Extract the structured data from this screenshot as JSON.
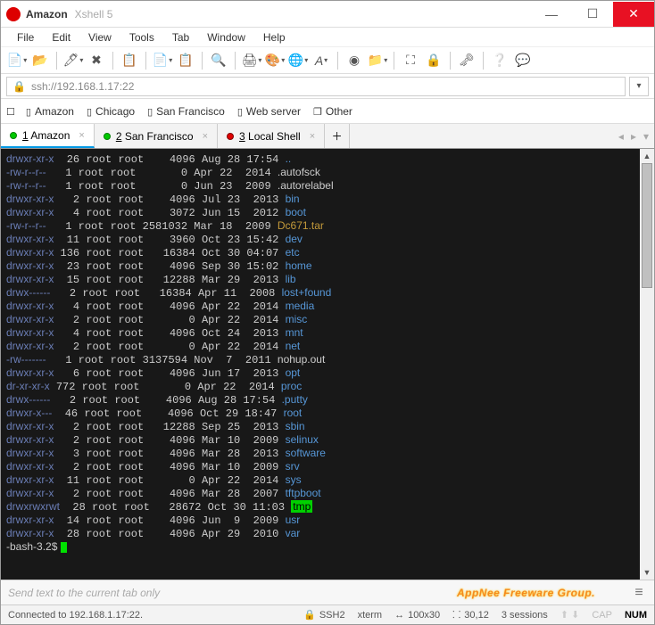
{
  "title": {
    "main": "Amazon",
    "sub": "Xshell 5"
  },
  "menu": [
    "File",
    "Edit",
    "View",
    "Tools",
    "Tab",
    "Window",
    "Help"
  ],
  "address": "ssh://192.168.1.17:22",
  "bookmarks": [
    "Amazon",
    "Chicago",
    "San Francisco",
    "Web server",
    "Other"
  ],
  "tabs": [
    {
      "dot": "green",
      "label": "1 Amazon",
      "active": true,
      "underline": "1"
    },
    {
      "dot": "green",
      "label": "2 San Francisco",
      "active": false,
      "underline": "2"
    },
    {
      "dot": "red",
      "label": "3 Local Shell",
      "active": false,
      "underline": "3"
    }
  ],
  "listing": [
    {
      "perm": "drwxr-xr-x",
      "n": "26",
      "u": "root",
      "g": "root",
      "sz": "4096",
      "d": "Aug 28 17:54",
      "name": "..",
      "cls": "dir"
    },
    {
      "perm": "-rw-r--r--",
      "n": "1",
      "u": "root",
      "g": "root",
      "sz": "0",
      "d": "Apr 22  2014",
      "name": ".autofsck",
      "cls": "file"
    },
    {
      "perm": "-rw-r--r--",
      "n": "1",
      "u": "root",
      "g": "root",
      "sz": "0",
      "d": "Jun 23  2009",
      "name": ".autorelabel",
      "cls": "file"
    },
    {
      "perm": "drwxr-xr-x",
      "n": "2",
      "u": "root",
      "g": "root",
      "sz": "4096",
      "d": "Jul 23  2013",
      "name": "bin",
      "cls": "dir"
    },
    {
      "perm": "drwxr-xr-x",
      "n": "4",
      "u": "root",
      "g": "root",
      "sz": "3072",
      "d": "Jun 15  2012",
      "name": "boot",
      "cls": "dir"
    },
    {
      "perm": "-rw-r--r--",
      "n": "1",
      "u": "root",
      "g": "root",
      "sz": "2581032",
      "d": "Mar 18  2009",
      "name": "Dc671.tar",
      "cls": "arch"
    },
    {
      "perm": "drwxr-xr-x",
      "n": "11",
      "u": "root",
      "g": "root",
      "sz": "3960",
      "d": "Oct 23 15:42",
      "name": "dev",
      "cls": "dir"
    },
    {
      "perm": "drwxr-xr-x",
      "n": "136",
      "u": "root",
      "g": "root",
      "sz": "16384",
      "d": "Oct 30 04:07",
      "name": "etc",
      "cls": "dir"
    },
    {
      "perm": "drwxr-xr-x",
      "n": "23",
      "u": "root",
      "g": "root",
      "sz": "4096",
      "d": "Sep 30 15:02",
      "name": "home",
      "cls": "dir"
    },
    {
      "perm": "drwxr-xr-x",
      "n": "15",
      "u": "root",
      "g": "root",
      "sz": "12288",
      "d": "Mar 29  2013",
      "name": "lib",
      "cls": "dir"
    },
    {
      "perm": "drwx------",
      "n": "2",
      "u": "root",
      "g": "root",
      "sz": "16384",
      "d": "Apr 11  2008",
      "name": "lost+found",
      "cls": "lost"
    },
    {
      "perm": "drwxr-xr-x",
      "n": "4",
      "u": "root",
      "g": "root",
      "sz": "4096",
      "d": "Apr 22  2014",
      "name": "media",
      "cls": "dir"
    },
    {
      "perm": "drwxr-xr-x",
      "n": "2",
      "u": "root",
      "g": "root",
      "sz": "0",
      "d": "Apr 22  2014",
      "name": "misc",
      "cls": "dir"
    },
    {
      "perm": "drwxr-xr-x",
      "n": "4",
      "u": "root",
      "g": "root",
      "sz": "4096",
      "d": "Oct 24  2013",
      "name": "mnt",
      "cls": "dir"
    },
    {
      "perm": "drwxr-xr-x",
      "n": "2",
      "u": "root",
      "g": "root",
      "sz": "0",
      "d": "Apr 22  2014",
      "name": "net",
      "cls": "dir"
    },
    {
      "perm": "-rw-------",
      "n": "1",
      "u": "root",
      "g": "root",
      "sz": "3137594",
      "d": "Nov  7  2011",
      "name": "nohup.out",
      "cls": "file"
    },
    {
      "perm": "drwxr-xr-x",
      "n": "6",
      "u": "root",
      "g": "root",
      "sz": "4096",
      "d": "Jun 17  2013",
      "name": "opt",
      "cls": "dir"
    },
    {
      "perm": "dr-xr-xr-x",
      "n": "772",
      "u": "root",
      "g": "root",
      "sz": "0",
      "d": "Apr 22  2014",
      "name": "proc",
      "cls": "dir"
    },
    {
      "perm": "drwx------",
      "n": "2",
      "u": "root",
      "g": "root",
      "sz": "4096",
      "d": "Aug 28 17:54",
      "name": ".putty",
      "cls": "dir"
    },
    {
      "perm": "drwxr-x---",
      "n": "46",
      "u": "root",
      "g": "root",
      "sz": "4096",
      "d": "Oct 29 18:47",
      "name": "root",
      "cls": "dir"
    },
    {
      "perm": "drwxr-xr-x",
      "n": "2",
      "u": "root",
      "g": "root",
      "sz": "12288",
      "d": "Sep 25  2013",
      "name": "sbin",
      "cls": "dir"
    },
    {
      "perm": "drwxr-xr-x",
      "n": "2",
      "u": "root",
      "g": "root",
      "sz": "4096",
      "d": "Mar 10  2009",
      "name": "selinux",
      "cls": "dir"
    },
    {
      "perm": "drwxr-xr-x",
      "n": "3",
      "u": "root",
      "g": "root",
      "sz": "4096",
      "d": "Mar 28  2013",
      "name": "software",
      "cls": "dir"
    },
    {
      "perm": "drwxr-xr-x",
      "n": "2",
      "u": "root",
      "g": "root",
      "sz": "4096",
      "d": "Mar 10  2009",
      "name": "srv",
      "cls": "dir"
    },
    {
      "perm": "drwxr-xr-x",
      "n": "11",
      "u": "root",
      "g": "root",
      "sz": "0",
      "d": "Apr 22  2014",
      "name": "sys",
      "cls": "dir"
    },
    {
      "perm": "drwxr-xr-x",
      "n": "2",
      "u": "root",
      "g": "root",
      "sz": "4096",
      "d": "Mar 28  2007",
      "name": "tftpboot",
      "cls": "dir"
    },
    {
      "perm": "drwxrwxrwt",
      "n": "28",
      "u": "root",
      "g": "root",
      "sz": "28672",
      "d": "Oct 30 11:03",
      "name": "tmp",
      "cls": "hl"
    },
    {
      "perm": "drwxr-xr-x",
      "n": "14",
      "u": "root",
      "g": "root",
      "sz": "4096",
      "d": "Jun  9  2009",
      "name": "usr",
      "cls": "dir"
    },
    {
      "perm": "drwxr-xr-x",
      "n": "28",
      "u": "root",
      "g": "root",
      "sz": "4096",
      "d": "Apr 29  2010",
      "name": "var",
      "cls": "dir"
    }
  ],
  "prompt": "-bash-3.2$ ",
  "input_placeholder": "Send text to the current tab only",
  "watermark": "AppNee Freeware Group.",
  "status": {
    "conn": "Connected to 192.168.1.17:22.",
    "proto": "SSH2",
    "termtype": "xterm",
    "size": "100x30",
    "cursor": "30,12",
    "sessions": "3 sessions",
    "cap": "CAP",
    "num": "NUM"
  }
}
